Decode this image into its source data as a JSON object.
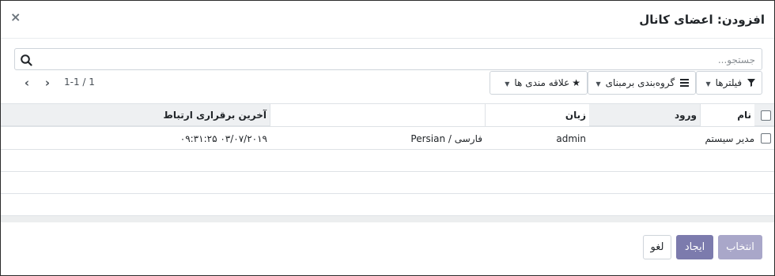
{
  "dialog": {
    "title": "افزودن: اعضای کانال",
    "close_glyph": "×"
  },
  "search": {
    "placeholder": "جستجو..."
  },
  "toolbar": {
    "filters_label": "فیلترها",
    "groupby_label": "گروه‌بندی برمبنای",
    "favorites_label": "علاقه مندی ها"
  },
  "pager": {
    "value": "1-1 / 1",
    "prev_glyph": "‹",
    "next_glyph": "›"
  },
  "table": {
    "columns": [
      "نام",
      "ورود",
      "زبان",
      "آخرین برقراری ارتباط"
    ],
    "rows": [
      {
        "name": "مدیر سیستم",
        "login": "admin",
        "language": "Persian / فارسی",
        "last_connection": "۰۳/۰۷/۲۰۱۹ ۰۹:۳۱:۲۵"
      }
    ]
  },
  "footer": {
    "select_label": "انتخاب",
    "create_label": "ایجاد",
    "cancel_label": "لغو"
  },
  "colors": {
    "primary": "#7c7bad",
    "primary_disabled": "#a9a7c9"
  },
  "icons": {
    "search": "search-icon",
    "filter": "filter-icon",
    "groupby": "bars-icon",
    "favorites": "star-icon",
    "close": "close-icon"
  }
}
